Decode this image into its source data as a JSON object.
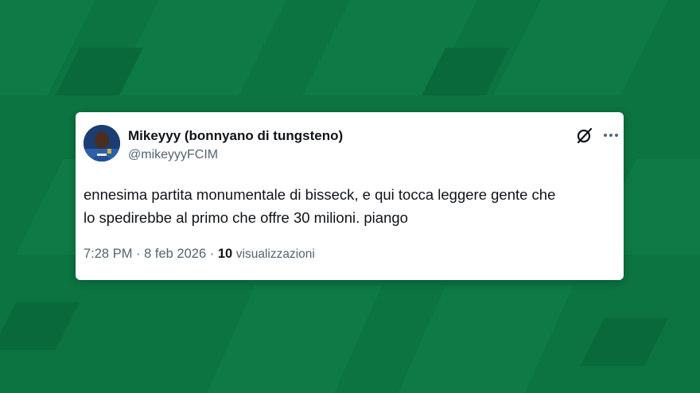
{
  "author": {
    "name": "Mikeyyy (bonnyano di tungsteno)",
    "handle": "@mikeyyyFCIM"
  },
  "tweet": {
    "text_line1": "ennesima partita monumentale di bisseck, e qui tocca leggere gente che",
    "text_line2": "lo spedirebbe al primo che offre 30 milioni. piango"
  },
  "meta": {
    "time": "7:28 PM",
    "separator1": "·",
    "date": "8 feb 2026",
    "separator2": "·",
    "views_count": "10",
    "views_label": "visualizzazioni"
  },
  "icons": {
    "grok": "grok-icon",
    "more": "more-options-icon"
  },
  "colors": {
    "background": "#0b7440",
    "card": "#ffffff",
    "text_primary": "#0f1419",
    "text_secondary": "#536471"
  }
}
